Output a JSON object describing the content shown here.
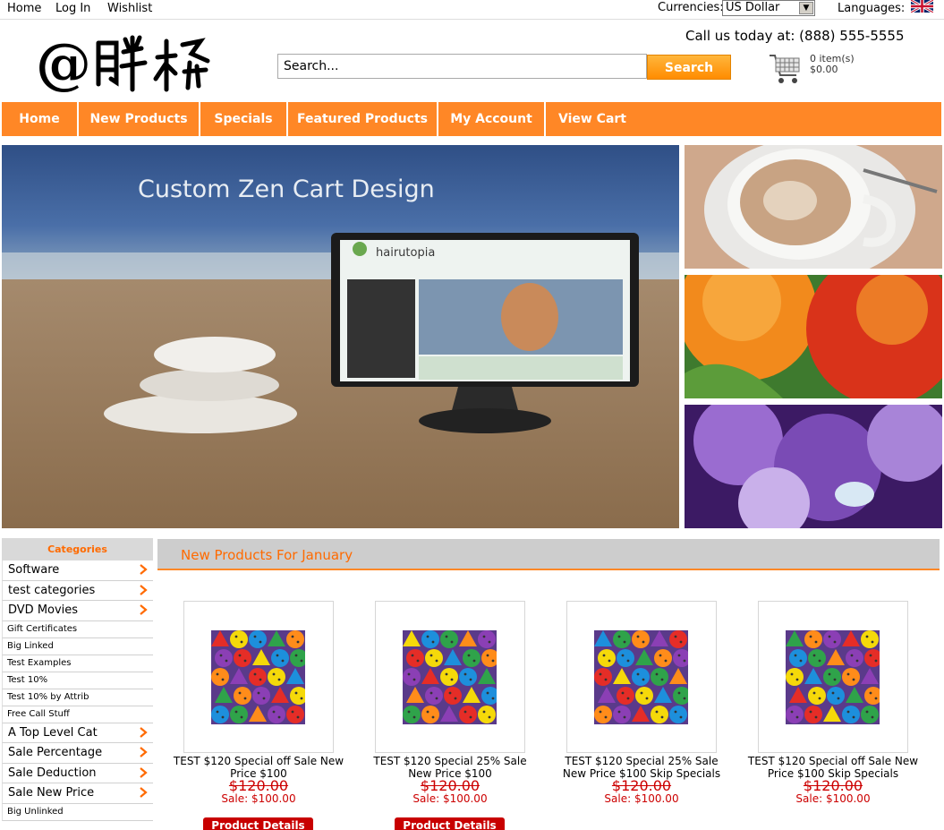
{
  "topbar": {
    "home": "Home",
    "login": "Log In",
    "wishlist": "Wishlist",
    "currencies_label": "Currencies:",
    "currency_selected": "US Dollar",
    "languages_label": "Languages:"
  },
  "header": {
    "logo_text": "@胖桥",
    "call_text": "Call us today at: (888) 555-5555",
    "search_placeholder": "Search...",
    "search_button": "Search",
    "cart_count": "0 item(s)",
    "cart_total": "$0.00"
  },
  "nav": [
    "Home",
    "New Products",
    "Specials",
    "Featured Products",
    "My Account",
    "View Cart"
  ],
  "banner": {
    "headline": "Custom Zen Cart Design",
    "screen_brand": "hairutopia"
  },
  "sidebar": {
    "title": "Categories",
    "items": [
      {
        "label": "Software",
        "size": "big",
        "arrow": true
      },
      {
        "label": "test categories",
        "size": "big",
        "arrow": true
      },
      {
        "label": "DVD Movies",
        "size": "big",
        "arrow": true
      },
      {
        "label": "Gift Certificates",
        "size": "small",
        "arrow": false
      },
      {
        "label": "Big Linked",
        "size": "small",
        "arrow": false
      },
      {
        "label": "Test Examples",
        "size": "small",
        "arrow": false
      },
      {
        "label": "Test 10%",
        "size": "small",
        "arrow": false
      },
      {
        "label": "Test 10% by Attrib",
        "size": "small",
        "arrow": false
      },
      {
        "label": "Free Call Stuff",
        "size": "small",
        "arrow": false
      },
      {
        "label": "A Top Level Cat",
        "size": "big",
        "arrow": true
      },
      {
        "label": "Sale Percentage",
        "size": "big",
        "arrow": true
      },
      {
        "label": "Sale Deduction",
        "size": "big",
        "arrow": true
      },
      {
        "label": "Sale New Price",
        "size": "big",
        "arrow": true
      },
      {
        "label": "Big Unlinked",
        "size": "small",
        "arrow": false
      }
    ]
  },
  "new_products": {
    "title": "New Products For January",
    "items": [
      {
        "name": "TEST $120 Special off Sale New Price $100",
        "old_price": "$120.00",
        "sale": "Sale: $100.00",
        "button": "Product Details"
      },
      {
        "name": "TEST $120 Special 25% Sale New Price $100",
        "old_price": "$120.00",
        "sale": "Sale: $100.00",
        "button": "Product Details"
      },
      {
        "name": "TEST $120 Special 25% Sale New Price $100 Skip Specials",
        "old_price": "$120.00",
        "sale": "Sale: $100.00",
        "button": "Product Details"
      },
      {
        "name": "TEST $120 Special off Sale New Price $100 Skip Specials",
        "old_price": "$120.00",
        "sale": "Sale: $100.00",
        "button": "Product Details"
      }
    ]
  },
  "colors": {
    "accent_orange": "#ff8726",
    "price_red": "#cc0000",
    "button_red": "#c80000"
  }
}
